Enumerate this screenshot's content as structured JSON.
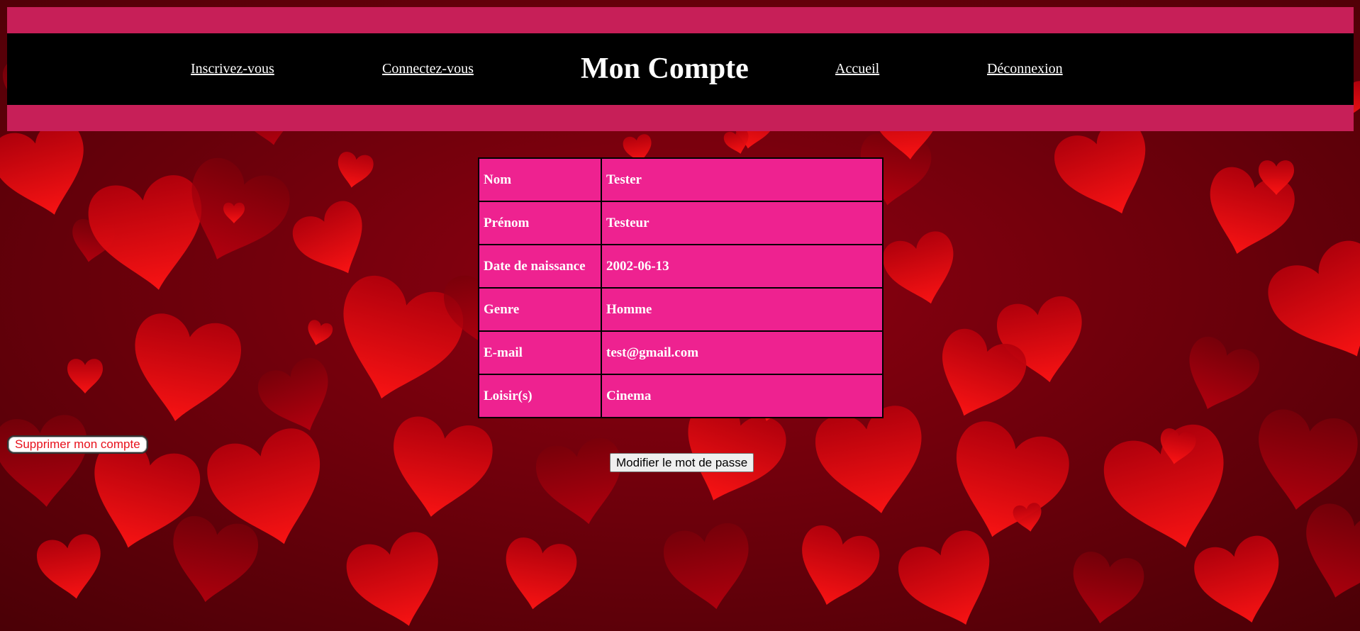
{
  "nav": {
    "register": "Inscrivez-vous",
    "login": "Connectez-vous",
    "title": "Mon Compte",
    "home": "Accueil",
    "logout": "Déconnexion"
  },
  "profile": {
    "rows": [
      {
        "label": "Nom",
        "value": "Tester"
      },
      {
        "label": "Prénom",
        "value": "Testeur"
      },
      {
        "label": "Date de naissance",
        "value": "2002-06-13"
      },
      {
        "label": "Genre",
        "value": "Homme"
      },
      {
        "label": "E-mail",
        "value": "test@gmail.com"
      },
      {
        "label": "Loisir(s)",
        "value": "Cinema"
      }
    ]
  },
  "actions": {
    "delete_account": "Supprimer mon compte",
    "change_password": "Modifier le mot de passe"
  },
  "colors": {
    "header_band": "#c71f58",
    "navbar": "#000000",
    "table_cell": "#ee2290",
    "background": "#6e0008",
    "heart": "#ff1a1a"
  },
  "background_image": {
    "icon": "hearts-pattern"
  }
}
